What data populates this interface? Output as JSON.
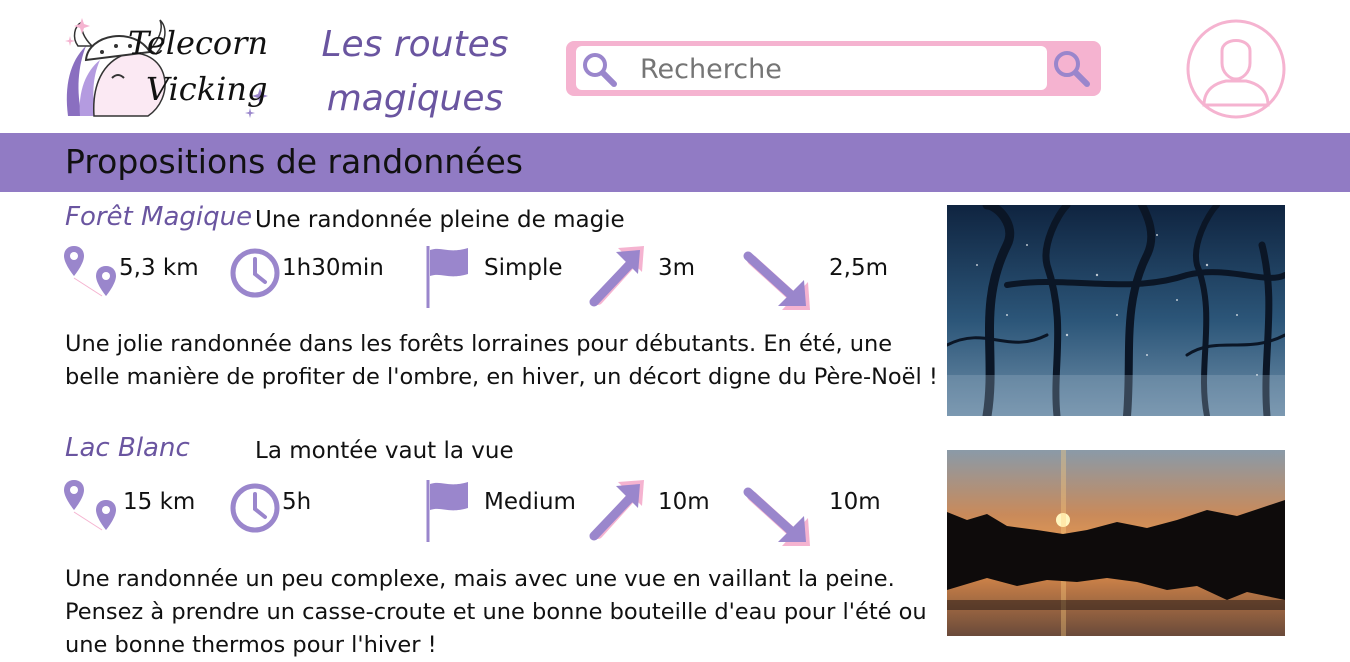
{
  "header": {
    "logo": {
      "line1": "Telecorn",
      "line2": "Vicking"
    },
    "site_title": "Les routes magiques",
    "search": {
      "placeholder": "Recherche",
      "value": ""
    }
  },
  "banner": {
    "title": "Propositions de randonnées"
  },
  "hikes": [
    {
      "name": "Forêt Magique",
      "tagline": "Une randonnée pleine de magie",
      "distance": "5,3 km",
      "duration": "1h30min",
      "difficulty": "Simple",
      "ascent": "3m",
      "descent": "2,5m",
      "description": "Une jolie randonnée dans les forêts lorraines pour débutants. En été, une belle manière de profiter de l'ombre, en hiver, un décort digne du Père-Noël !",
      "photo": "misty-blue-forest"
    },
    {
      "name": "Lac Blanc",
      "tagline": "La montée vaut la vue",
      "distance": "15 km",
      "duration": "5h",
      "difficulty": "Medium",
      "ascent": "10m",
      "descent": "10m",
      "description": "Une randonnée un peu complexe, mais avec une vue en vaillant la peine. Pensez à prendre un casse-croute et une bonne bouteille d'eau pour l'été ou une bonne thermos pour l'hiver !",
      "photo": "sunset-lake"
    }
  ],
  "colors": {
    "accent_purple": "#917bc4",
    "title_purple": "#6a55a0",
    "icon_purple": "#9a86cc",
    "pink": "#f5b3d0"
  },
  "icons": [
    "logo-unicorn-viking",
    "search-icon",
    "profile-icon",
    "map-pin-icon",
    "clock-icon",
    "flag-icon",
    "arrow-up-icon",
    "arrow-down-icon"
  ]
}
